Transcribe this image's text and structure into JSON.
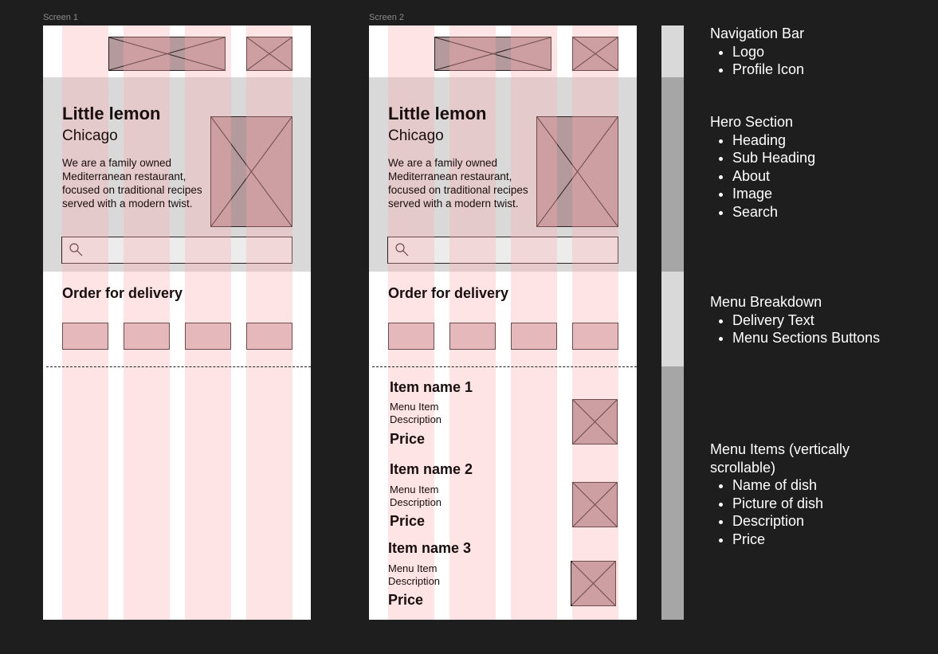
{
  "screens": [
    {
      "frame_label": "Screen 1",
      "hero": {
        "heading": "Little lemon",
        "subheading": "Chicago",
        "about": "We are a family owned Mediterranean restaurant, focused on traditional recipes served with a modern twist."
      },
      "menu_breakdown": {
        "delivery_text": "Order for delivery"
      },
      "menu_items": []
    },
    {
      "frame_label": "Screen 2",
      "hero": {
        "heading": "Little lemon",
        "subheading": "Chicago",
        "about": "We are a family owned Mediterranean restaurant, focused on traditional recipes served with a modern twist."
      },
      "menu_breakdown": {
        "delivery_text": "Order for delivery"
      },
      "menu_items": [
        {
          "name": "Item name 1",
          "description": "Menu Item Description",
          "price": "Price"
        },
        {
          "name": "Item name 2",
          "description": "Menu Item Description",
          "price": "Price"
        },
        {
          "name": "Item name 3",
          "description": "Menu Item Description",
          "price": "Price"
        }
      ]
    }
  ],
  "annotations": [
    {
      "title": "Navigation Bar",
      "items": [
        "Logo",
        "Profile Icon"
      ]
    },
    {
      "title": "Hero Section",
      "items": [
        "Heading",
        "Sub Heading",
        "About",
        "Image",
        "Search"
      ]
    },
    {
      "title": "Menu Breakdown",
      "items": [
        "Delivery Text",
        "Menu Sections Buttons"
      ]
    },
    {
      "title": "Menu Items (vertically scrollable)",
      "items": [
        "Name of dish",
        "Picture of dish",
        "Description",
        "Price"
      ]
    }
  ],
  "colors": {
    "background": "#1e1e1e",
    "screen": "#ffffff",
    "hero_band": "#d9d9d9",
    "layout_grid": "#ffaaaf",
    "placeholder": "#b59a9d",
    "side_light": "#d9d9d9",
    "side_dark": "#a6a6a6"
  },
  "icons": [
    "image-placeholder-icon",
    "search-icon"
  ]
}
